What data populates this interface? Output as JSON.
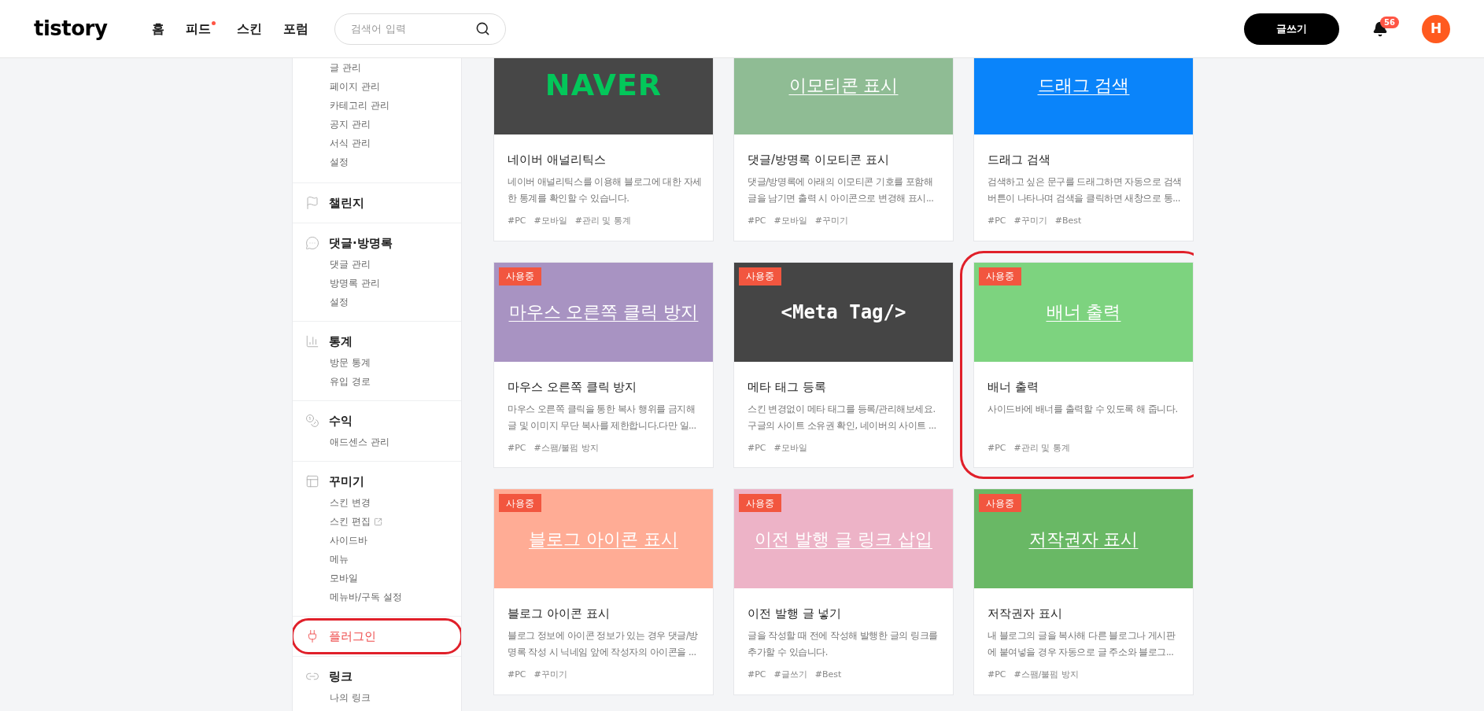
{
  "header": {
    "logo": "tistory",
    "nav": [
      {
        "label": "홈",
        "new": false
      },
      {
        "label": "피드",
        "new": true
      },
      {
        "label": "스킨",
        "new": false
      },
      {
        "label": "포럼",
        "new": false
      }
    ],
    "search": {
      "placeholder": "검색어 입력"
    },
    "write_button": "글쓰기",
    "notifications": "56",
    "avatar": "H"
  },
  "sidebar": {
    "groups": [
      {
        "items": [
          {
            "label": "글 관리",
            "external": false
          },
          {
            "label": "페이지 관리",
            "external": false
          },
          {
            "label": "카테고리 관리",
            "external": false
          },
          {
            "label": "공지 관리",
            "external": false
          },
          {
            "label": "서식 관리",
            "external": false
          },
          {
            "label": "설정",
            "external": false
          }
        ]
      },
      {
        "title": "챌린지",
        "selected": false,
        "annotated": false
      },
      {
        "title": "댓글·방명록",
        "selected": false,
        "annotated": false,
        "items": [
          {
            "label": "댓글 관리",
            "external": false
          },
          {
            "label": "방명록 관리",
            "external": false
          },
          {
            "label": "설정",
            "external": false
          }
        ]
      },
      {
        "title": "통계",
        "selected": false,
        "annotated": false,
        "items": [
          {
            "label": "방문 통계",
            "external": false
          },
          {
            "label": "유입 경로",
            "external": false
          }
        ]
      },
      {
        "title": "수익",
        "selected": false,
        "annotated": false,
        "items": [
          {
            "label": "애드센스 관리",
            "external": false
          }
        ]
      },
      {
        "title": "꾸미기",
        "selected": false,
        "annotated": false,
        "items": [
          {
            "label": "스킨 변경",
            "external": false
          },
          {
            "label": "스킨 편집",
            "external": true
          },
          {
            "label": "사이드바",
            "external": false
          },
          {
            "label": "메뉴",
            "external": false
          },
          {
            "label": "모바일",
            "external": false
          },
          {
            "label": "메뉴바/구독 설정",
            "external": false
          }
        ]
      },
      {
        "title": "플러그인",
        "selected": true,
        "annotated": true
      },
      {
        "title": "링크",
        "selected": false,
        "annotated": false,
        "items": [
          {
            "label": "나의 링크",
            "external": false
          }
        ]
      }
    ]
  },
  "cards": [
    {
      "banner": {
        "kind": "logo",
        "text": "NAVER",
        "color": "#474747"
      },
      "annotated": false,
      "title": "네이버 애널리틱스",
      "desc_lines": [
        "네이버 애널리틱스를 이용해 블로그에 대한 자세",
        "한 통계를 확인할 수 있습니다."
      ],
      "tags": [
        "#PC",
        "#모바일",
        "#관리 및 통계"
      ]
    },
    {
      "banner": {
        "kind": "title",
        "text": "이모티콘 표시",
        "color": "#8fbc94"
      },
      "annotated": false,
      "title": "댓글/방명록 이모티콘 표시",
      "desc_lines": [
        "댓글/방명록에 아래의 이모티콘 기호를 포함해",
        "글을 남기면 출력 시 아이콘으로 변경해 표시..."
      ],
      "tags": [
        "#PC",
        "#모바일",
        "#꾸미기"
      ]
    },
    {
      "banner": {
        "kind": "title",
        "text": "드래그 검색",
        "color": "#0a84fa"
      },
      "annotated": false,
      "title": "드래그 검색",
      "desc_lines": [
        "검색하고 싶은 문구를 드래그하면 자동으로 검색",
        "버튼이 나타나며 검색을 클릭하면 새창으로 통..."
      ],
      "tags": [
        "#PC",
        "#꾸미기",
        "#Best"
      ]
    },
    {
      "banner": {
        "kind": "title",
        "text": "마우스 오른쪽 클릭 방지",
        "color": "#a893c2"
      },
      "badge": "사용중",
      "annotated": false,
      "title": "마우스 오른쪽 클릭 방지",
      "desc_lines": [
        "마우스 오른쪽 클릭을 통한 복사 행위를 금지해",
        "글 및 이미지 무단 복사를 제한합니다.다만 일..."
      ],
      "tags": [
        "#PC",
        "#스팸/불펌 방지"
      ]
    },
    {
      "banner": {
        "kind": "code",
        "text": "<Meta Tag/>",
        "color": "#454545"
      },
      "badge": "사용중",
      "annotated": false,
      "title": "메타 태그 등록",
      "desc_lines": [
        "스킨 변경없이 메타 태그를 등록/관리해보세요.",
        "구글의 사이트 소유권 확인, 네이버의 사이트 ..."
      ],
      "tags": [
        "#PC",
        "#모바일"
      ]
    },
    {
      "banner": {
        "kind": "title",
        "text": "배너 출력",
        "color": "#7dd37f"
      },
      "badge": "사용중",
      "annotated": true,
      "title": "배너 출력",
      "desc_lines": [
        "사이드바에 배너를 출력할 수 있도록 해 줍니다."
      ],
      "tags": [
        "#PC",
        "#관리 및 통계"
      ]
    },
    {
      "banner": {
        "kind": "title",
        "text": "블로그 아이콘 표시",
        "color": "#ffac95"
      },
      "badge": "사용중",
      "annotated": false,
      "title": "블로그 아이콘 표시",
      "desc_lines": [
        "블로그 정보에 아이콘 정보가 있는 경우 댓글/방",
        "명록 작성 시 닉네임 앞에 작성자의 아이콘을 ..."
      ],
      "tags": [
        "#PC",
        "#꾸미기"
      ]
    },
    {
      "banner": {
        "kind": "title",
        "text": "이전 발행 글 링크 삽입",
        "color": "#edb3c7"
      },
      "badge": "사용중",
      "annotated": false,
      "title": "이전 발행 글 넣기",
      "desc_lines": [
        "글을 작성할 때 전에 작성해 발행한 글의 링크를",
        "추가할 수 있습니다."
      ],
      "tags": [
        "#PC",
        "#글쓰기",
        "#Best"
      ]
    },
    {
      "banner": {
        "kind": "title",
        "text": "저작권자 표시",
        "color": "#69b865"
      },
      "badge": "사용중",
      "annotated": false,
      "title": "저작권자 표시",
      "desc_lines": [
        "내 블로그의 글을 복사해 다른 블로그나 게시판",
        "에 붙여넣을 경우 자동으로 글 주소와 블로그..."
      ],
      "tags": [
        "#PC",
        "#스팸/불펌 방지"
      ]
    }
  ]
}
